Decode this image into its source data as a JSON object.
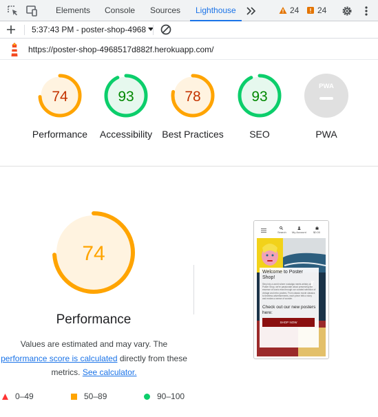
{
  "devtools": {
    "tabs": [
      {
        "label": "Elements",
        "active": false
      },
      {
        "label": "Console",
        "active": false
      },
      {
        "label": "Sources",
        "active": false
      },
      {
        "label": "Lighthouse",
        "active": true
      }
    ],
    "warnings_count": "24",
    "issues_count": "24"
  },
  "toolbar": {
    "report_selector": "5:37:43 PM - poster-shop-4968"
  },
  "report": {
    "url": "https://poster-shop-4968517d882f.herokuapp.com/"
  },
  "categories": [
    {
      "label": "Performance",
      "score": 74,
      "status": "average"
    },
    {
      "label": "Accessibility",
      "score": 93,
      "status": "pass"
    },
    {
      "label": "Best Practices",
      "score": 78,
      "status": "average"
    },
    {
      "label": "SEO",
      "score": 93,
      "status": "pass"
    },
    {
      "label": "PWA",
      "score": null,
      "status": "na",
      "badge_text": "PWA"
    }
  ],
  "main": {
    "score": "74",
    "title": "Performance",
    "note_prefix": "Values are estimated and may vary. The",
    "note_link1": "performance score is calculated",
    "note_middle": "directly from these metrics.",
    "note_link2": "See calculator."
  },
  "legend": [
    {
      "range": "0–49",
      "shape": "triangle",
      "color": "#ff3333"
    },
    {
      "range": "50–89",
      "shape": "square",
      "color": "#ffa400"
    },
    {
      "range": "90–100",
      "shape": "circle",
      "color": "#0cce6b"
    }
  ],
  "screenshot": {
    "nav_search": "Search",
    "nav_account": "My Account",
    "nav_bag": "$0.00",
    "heading": "Welcome to Poster Shop!",
    "body": "Step into a world where nostalgia meets artistry at Poster Shop, we're passionate about preserving the essence of iconic eras through our curated selection of vintage and retro posters. From classic movie classics to timeless advertisements, each piece tells a story and evokes a sense of wonder.",
    "subheading": "Check out our new posters here:",
    "button": "SHOP NOW"
  },
  "colors": {
    "accent": "#1a73e8",
    "average": "#ffa400",
    "average_text": "#c33300",
    "pass": "#0cce6b",
    "pass_text": "#008800",
    "na": "#e0e0e0"
  }
}
